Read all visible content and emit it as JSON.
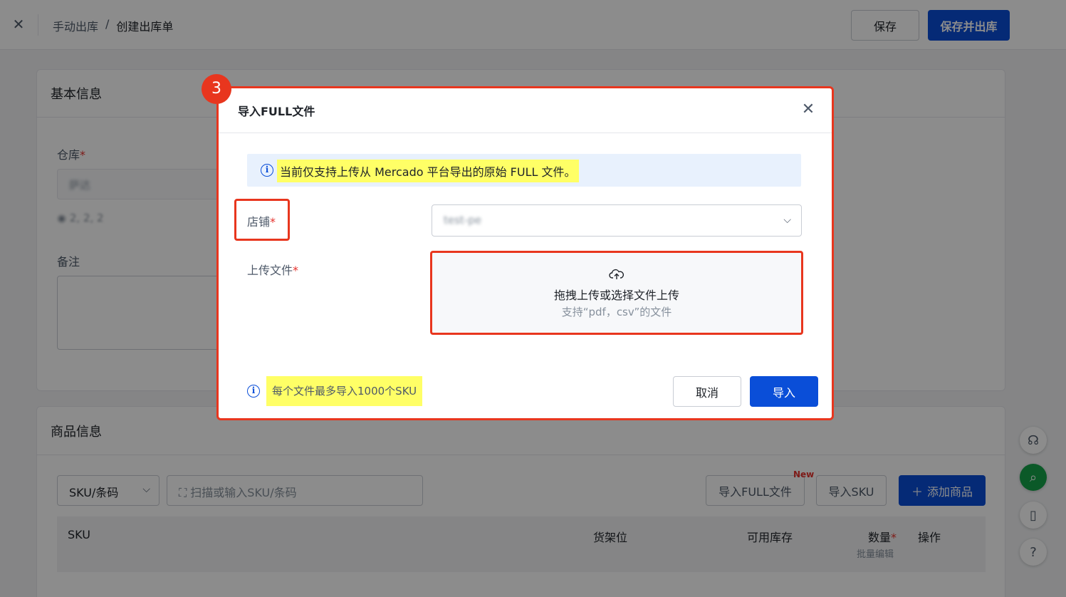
{
  "topbar": {
    "close_icon": "close-icon",
    "breadcrumb": [
      "手动出库",
      "/",
      "创建出库单"
    ],
    "save_label": "保存",
    "save_and_out_label": "保存并出库"
  },
  "basic_info": {
    "title": "基本信息",
    "warehouse_label": "仓库",
    "warehouse_value": "萨达",
    "warehouse_address": "2, 2, 2",
    "remark_label": "备注"
  },
  "product_info": {
    "title": "商品信息",
    "search_type": "SKU/条码",
    "scan_placeholder": "扫描或输入SKU/条码",
    "import_full_label": "导入FULL文件",
    "new_tag": "New",
    "import_sku_label": "导入SKU",
    "add_product_label": "添加商品",
    "columns": {
      "sku": "SKU",
      "shelf": "货架位",
      "available": "可用库存",
      "quantity": "数量",
      "quantity_sub": "批量编辑",
      "action": "操作"
    }
  },
  "modal": {
    "step_number": "3",
    "title": "导入FULL文件",
    "info_text": "当前仅支持上传从 Mercado 平台导出的原始 FULL 文件。",
    "shop_label": "店铺",
    "shop_value": "test-pe",
    "upload_label": "上传文件",
    "upload_main": "拖拽上传或选择文件上传",
    "upload_hint": "支持“pdf，csv”的文件",
    "footer_note": "每个文件最多导入1000个SKU",
    "cancel_label": "取消",
    "import_label": "导入"
  },
  "colors": {
    "primary": "#0a4ed8",
    "annotation": "#e8361e",
    "highlight": "#ffff66"
  }
}
